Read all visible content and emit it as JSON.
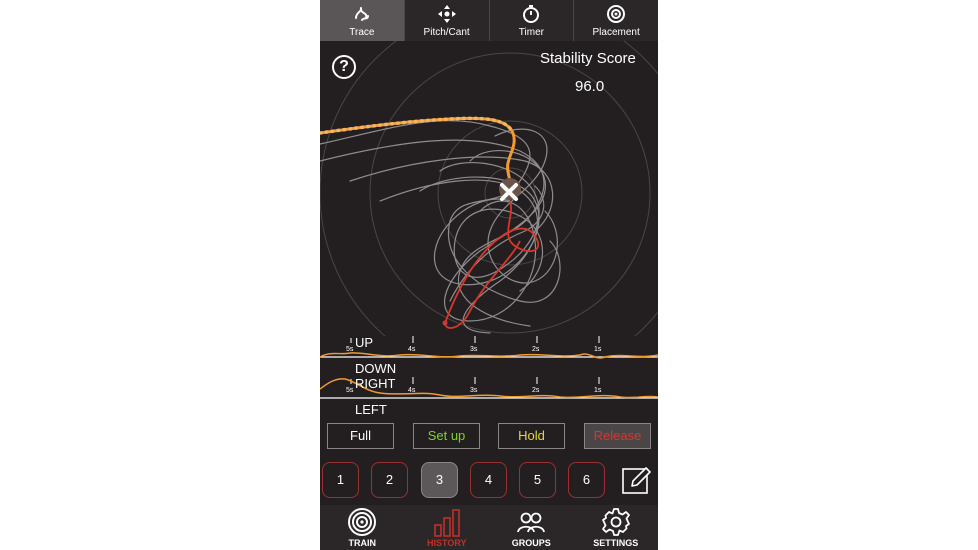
{
  "tabs": [
    {
      "label": "Trace",
      "icon": "trace-icon",
      "active": true
    },
    {
      "label": "Pitch/Cant",
      "icon": "pitch-cant-icon",
      "active": false
    },
    {
      "label": "Timer",
      "icon": "timer-icon",
      "active": false
    },
    {
      "label": "Placement",
      "icon": "placement-icon",
      "active": false
    }
  ],
  "help_label": "?",
  "score": {
    "label": "Stability Score",
    "value": "96.0"
  },
  "strips": {
    "labels": {
      "up": "UP",
      "down": "DOWN",
      "right": "RIGHT",
      "left": "LEFT"
    },
    "ticks": [
      "5s",
      "4s",
      "3s",
      "2s",
      "1s"
    ]
  },
  "phases": {
    "full": "Full",
    "setup": "Set up",
    "hold": "Hold",
    "release": "Release"
  },
  "shots": [
    "1",
    "2",
    "3",
    "4",
    "5",
    "6"
  ],
  "active_shot": "3",
  "nav": [
    {
      "label": "TRAIN",
      "icon": "target-icon"
    },
    {
      "label": "HISTORY",
      "icon": "history-bars-icon",
      "active": true
    },
    {
      "label": "GROUPS",
      "icon": "groups-icon"
    },
    {
      "label": "SETTINGS",
      "icon": "gear-icon"
    }
  ],
  "colors": {
    "background": "#231f20",
    "trace_orange": "#f39a2d",
    "trace_red": "#d9362b",
    "trace_gray": "#8f8c8d",
    "setup_green": "#7ed321",
    "hold_yellow": "#e4d93a",
    "release_red": "#d9362b",
    "history_red": "#c0302a"
  }
}
